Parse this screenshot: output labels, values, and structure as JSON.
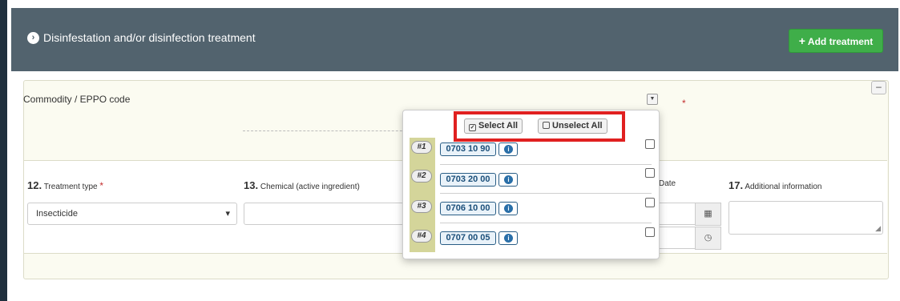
{
  "section": {
    "title": "Disinfestation and/or disinfection treatment",
    "add_button": "Add treatment",
    "add_button_icon": "plus-icon"
  },
  "commodity": {
    "label": "Commodity / EPPO code",
    "required_marker": "*"
  },
  "columns": {
    "treatment_type": {
      "number": "12.",
      "label": "Treatment type",
      "required_marker": "*"
    },
    "chemical": {
      "number": "13.",
      "label": "Chemical (active ingredient)"
    },
    "date": {
      "label": "Date"
    },
    "additional": {
      "number": "17.",
      "label": "Additional information"
    }
  },
  "treatment_select": {
    "value": "Insecticide"
  },
  "popup": {
    "select_all": "Select All",
    "unselect_all": "Unselect All",
    "items": [
      {
        "badge": "#1",
        "code": "0703 10 90"
      },
      {
        "badge": "#2",
        "code": "0703 20 00"
      },
      {
        "badge": "#3",
        "code": "0706 10 00"
      },
      {
        "badge": "#4",
        "code": "0707 00 05"
      }
    ]
  },
  "colors": {
    "header_bg": "#52636e",
    "add_button": "#3fae49",
    "highlight": "#e02020",
    "code_blue": "#1b4f7a"
  }
}
